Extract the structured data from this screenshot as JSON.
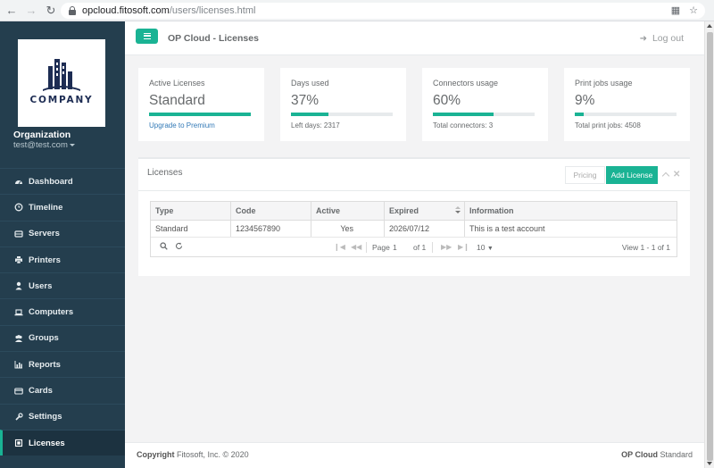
{
  "browser": {
    "url_host": "opcloud.fitosoft.com",
    "url_path": "/users/licenses.html"
  },
  "sidebar": {
    "logo_text": "COMPANY",
    "org_label": "Organization",
    "org_email": "test@test.com",
    "items": [
      {
        "label": "Dashboard",
        "icon": "dashboard-icon"
      },
      {
        "label": "Timeline",
        "icon": "clock-icon"
      },
      {
        "label": "Servers",
        "icon": "server-icon"
      },
      {
        "label": "Printers",
        "icon": "printer-icon"
      },
      {
        "label": "Users",
        "icon": "user-icon"
      },
      {
        "label": "Computers",
        "icon": "laptop-icon"
      },
      {
        "label": "Groups",
        "icon": "users-icon"
      },
      {
        "label": "Reports",
        "icon": "chart-icon"
      },
      {
        "label": "Cards",
        "icon": "card-icon"
      },
      {
        "label": "Settings",
        "icon": "wrench-icon"
      },
      {
        "label": "Licenses",
        "icon": "key-icon",
        "active": true
      }
    ]
  },
  "header": {
    "title": "OP Cloud - Licenses",
    "logout": "Log out"
  },
  "cards": [
    {
      "label": "Active Licenses",
      "value": "Standard",
      "progress": 1.0,
      "footer": "Upgrade to Premium",
      "footer_link": true
    },
    {
      "label": "Days used",
      "value": "37%",
      "progress": 0.37,
      "footer": "Left days: 2317",
      "footer_link": false
    },
    {
      "label": "Connectors usage",
      "value": "60%",
      "progress": 0.6,
      "footer": "Total connectors: 3",
      "footer_link": false
    },
    {
      "label": "Print jobs usage",
      "value": "9%",
      "progress": 0.09,
      "footer": "Total print jobs: 4508",
      "footer_link": false
    }
  ],
  "licenses": {
    "title": "Licenses",
    "pricing_button": "Pricing",
    "add_button": "Add License",
    "columns": [
      "Type",
      "Code",
      "Active",
      "Expired",
      "Information"
    ],
    "rows": [
      [
        "Standard",
        "1234567890",
        "Yes",
        "2026/07/12",
        "This is a test account"
      ]
    ],
    "pager": {
      "page_label": "Page",
      "page": "1",
      "of": "of 1",
      "page_size": "10",
      "view": "View 1 - 1 of 1"
    }
  },
  "footer": {
    "copyright_label": "Copyright",
    "copyright_text": "Fitosoft, Inc. © 2020",
    "product_bold": "OP Cloud",
    "product_edition": "Standard"
  },
  "colors": {
    "accent": "#1ab394",
    "sidebar": "#243e4e",
    "link": "#337ab7"
  }
}
